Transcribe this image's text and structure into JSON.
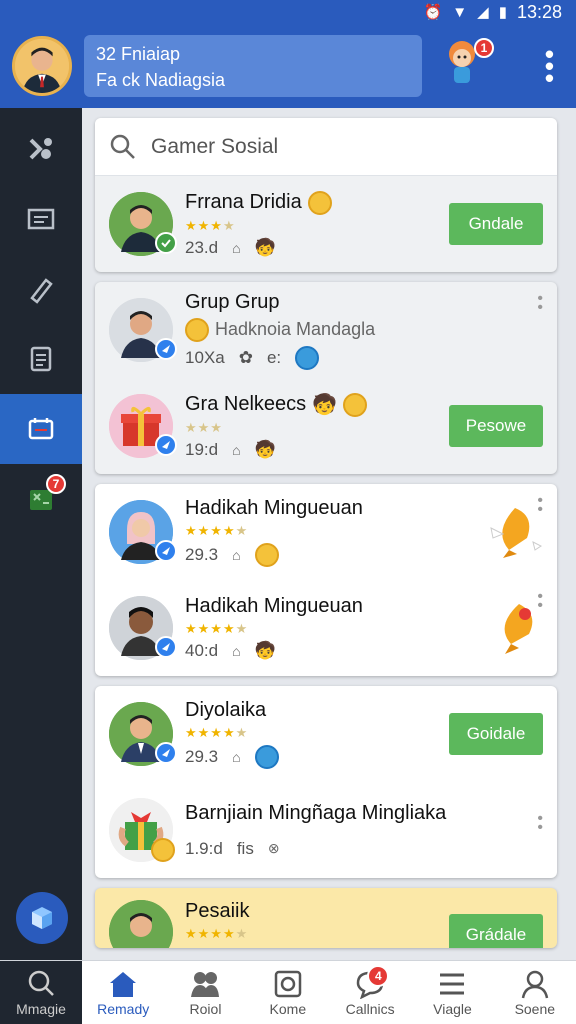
{
  "status": {
    "time": "13:28"
  },
  "header": {
    "line1": "32 Fniaiap",
    "line2": "Fa ck Nadiagsia",
    "notification_count": "1"
  },
  "sidebar": {
    "badge": "7"
  },
  "search": {
    "placeholder": "Gamer Sosial"
  },
  "cards": [
    {
      "rows": [
        {
          "name": "Frrana Dridia",
          "meta": "23.d",
          "button": "Gndale"
        }
      ]
    },
    {
      "rows": [
        {
          "name": "Grup Grup",
          "subtitle": "Hadknoia Mandagla",
          "meta": "10Xa",
          "extra": "e:"
        },
        {
          "name": "Gra Nelkeecs",
          "meta": "19:d",
          "button": "Pesowe"
        }
      ]
    },
    {
      "rows": [
        {
          "name": "Hadikah Mingueuan",
          "meta": "29.3"
        },
        {
          "name": "Hadikah Mingueuan",
          "meta": "40:d"
        }
      ]
    },
    {
      "rows": [
        {
          "name": "Diyolaika",
          "meta": "29.3",
          "button": "Goidale"
        },
        {
          "name": "Barnjiain Mingñaga Mingliaka",
          "meta": "1.9:d",
          "extra": "fis"
        }
      ]
    },
    {
      "rows": [
        {
          "name": "Pesaiik",
          "button": "Grádale"
        }
      ]
    }
  ],
  "bottom_nav": [
    {
      "label": "Mmagie",
      "icon": "search-icon"
    },
    {
      "label": "Remady",
      "icon": "home-icon"
    },
    {
      "label": "Roiol",
      "icon": "people-icon"
    },
    {
      "label": "Kome",
      "icon": "camera-icon"
    },
    {
      "label": "Callnics",
      "icon": "chat-icon",
      "badge": "4"
    },
    {
      "label": "Viagle",
      "icon": "list-icon"
    },
    {
      "label": "Soene",
      "icon": "profile-icon"
    }
  ],
  "colors": {
    "primary": "#2a5bbd",
    "button_green": "#5cb85c",
    "sidebar": "#1f2630",
    "highlight_card": "#fbe8a8"
  }
}
